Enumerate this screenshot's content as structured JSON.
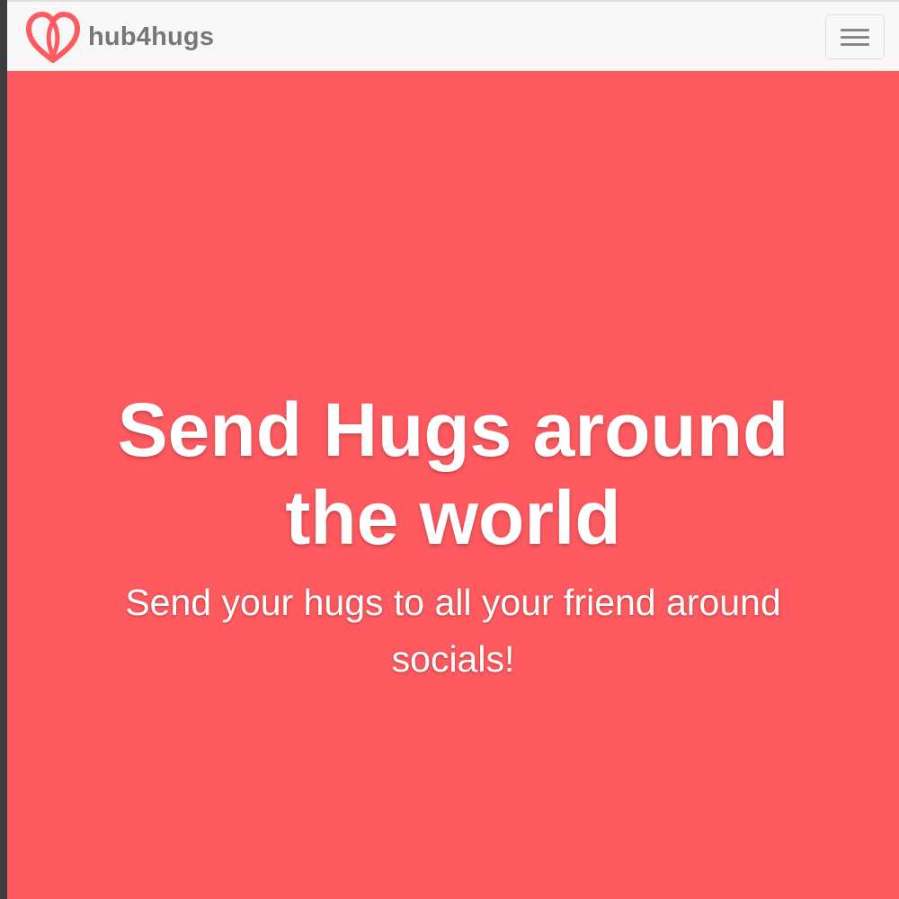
{
  "navbar": {
    "brand_name": "hub4hugs",
    "logo_icon": "heart-logo-icon",
    "menu_icon": "hamburger-menu-icon"
  },
  "hero": {
    "title": "Send Hugs around the world",
    "subtitle": "Send your hugs to all your friend around socials!"
  },
  "colors": {
    "brand": "#ff5a5f",
    "navbar_bg": "#f8f8f8",
    "brand_text": "#777777",
    "hero_text": "#ffffff"
  }
}
